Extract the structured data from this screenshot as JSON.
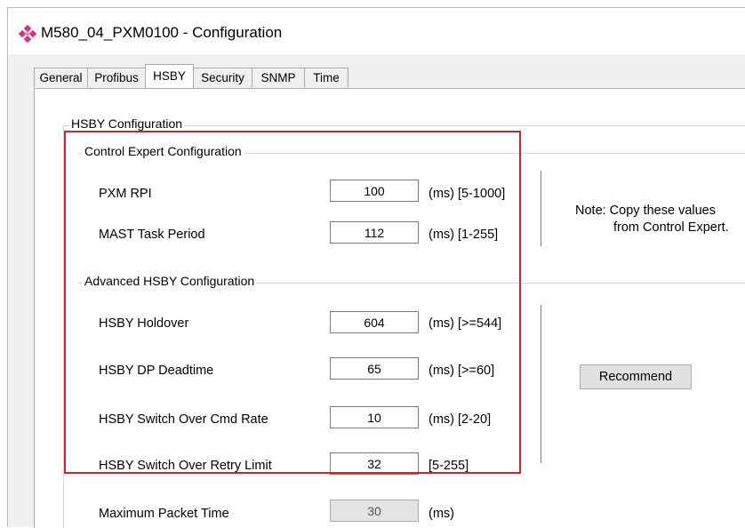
{
  "window": {
    "title": "M580_04_PXM0100 - Configuration"
  },
  "tabs": [
    {
      "label": "General"
    },
    {
      "label": "Profibus"
    },
    {
      "label": "HSBY"
    },
    {
      "label": "Security"
    },
    {
      "label": "SNMP"
    },
    {
      "label": "Time"
    }
  ],
  "active_tab": "HSBY",
  "hsby": {
    "group_title": "HSBY Configuration",
    "control_expert": {
      "title": "Control Expert Configuration",
      "pxm_rpi": {
        "label": "PXM RPI",
        "value": "100",
        "unit": "(ms) [5-1000]"
      },
      "mast_task_period": {
        "label": "MAST Task Period",
        "value": "112",
        "unit": "(ms) [1-255]"
      },
      "note_line1": "Note: Copy these values",
      "note_line2": "from Control Expert."
    },
    "advanced": {
      "title": "Advanced HSBY Configuration",
      "holdover": {
        "label": "HSBY Holdover",
        "value": "604",
        "unit": "(ms) [>=544]"
      },
      "dp_deadtime": {
        "label": "HSBY DP Deadtime",
        "value": "65",
        "unit": "(ms) [>=60]"
      },
      "switch_cmd_rate": {
        "label": "HSBY Switch Over Cmd Rate",
        "value": "10",
        "unit": "(ms) [2-20]"
      },
      "switch_retry_limit": {
        "label": "HSBY Switch Over Retry Limit",
        "value": "32",
        "unit": "[5-255]"
      },
      "recommend_label": "Recommend"
    },
    "max_packet_time": {
      "label": "Maximum Packet Time",
      "value": "30",
      "unit": "(ms)"
    }
  },
  "colors": {
    "highlight": "#d6212b",
    "icon": "#e0307a"
  }
}
